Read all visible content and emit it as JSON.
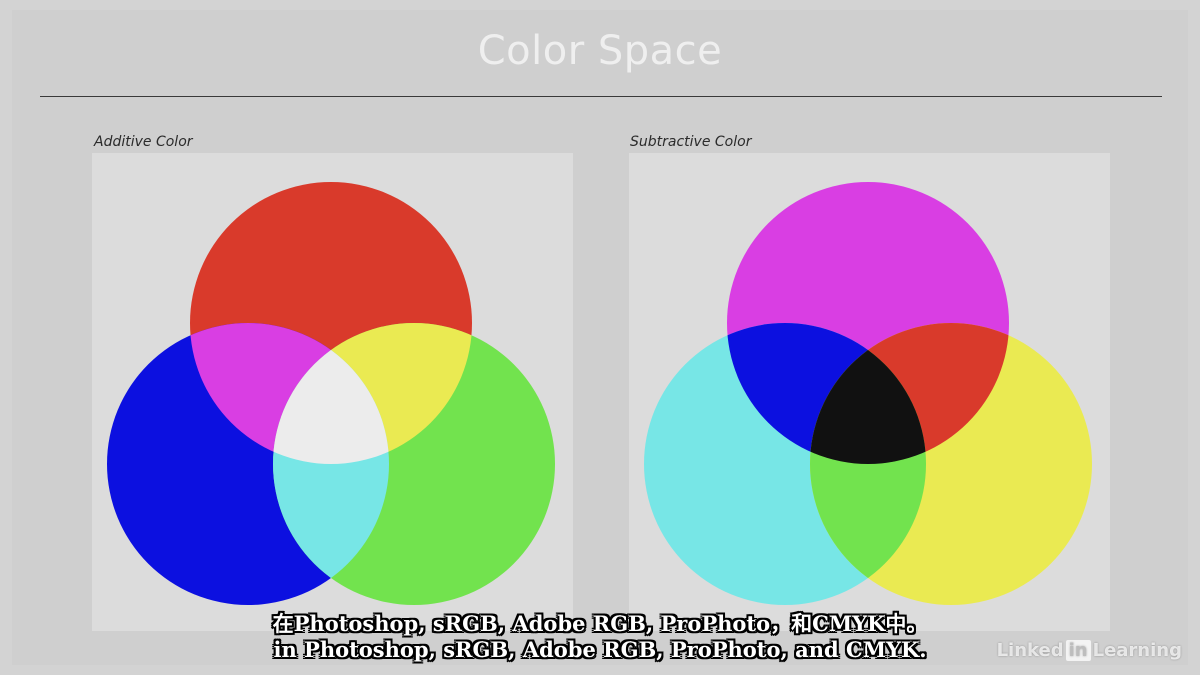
{
  "slide": {
    "title": "Color Space",
    "panels": [
      {
        "label": "Additive Color"
      },
      {
        "label": "Subtractive Color"
      }
    ]
  },
  "subtitles": {
    "line1": "在Photoshop, sRGB, Adobe RGB, ProPhoto，和CMYK中。",
    "line2": "in Photoshop, sRGB, Adobe RGB, ProPhoto, and CMYK."
  },
  "brand": {
    "part1": "Linked",
    "part2": "in",
    "part3": "Learning"
  },
  "colors": {
    "red": "#d93a2b",
    "green": "#72e34e",
    "blue": "#0c10e0",
    "magenta": "#d93ee3",
    "yellow": "#eaea52",
    "cyan": "#77e6e6",
    "white": "#ececec",
    "black": "#111111"
  }
}
